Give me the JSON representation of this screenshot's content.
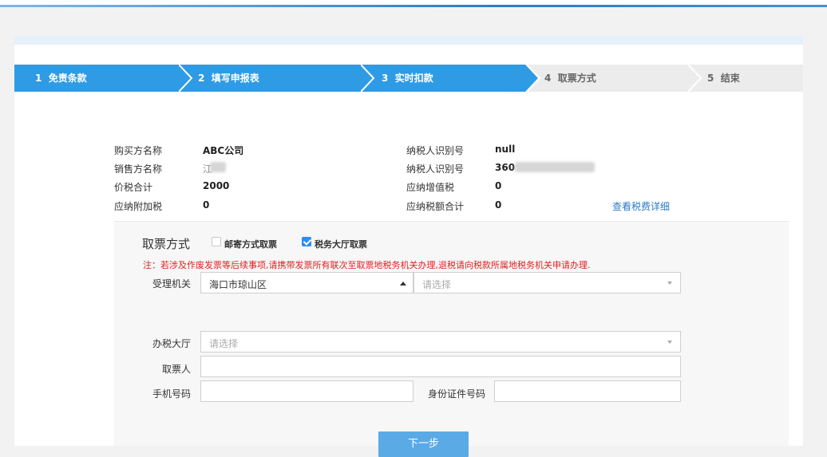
{
  "steps": [
    {
      "number": "1",
      "label": "免责条款"
    },
    {
      "number": "2",
      "label": "填写申报表"
    },
    {
      "number": "3",
      "label": "实时扣款"
    },
    {
      "number": "4",
      "label": "取票方式"
    },
    {
      "number": "5",
      "label": "结束"
    }
  ],
  "colors": {
    "step_active": "#2f9be4",
    "step_inactive": "#ececec",
    "accent": "#2d8cf0",
    "notice": "#e02020",
    "link": "#2a7ac7",
    "button": "#5aaae6"
  },
  "info": {
    "buyer_name_label": "购买方名称",
    "buyer_name_value": "ABC公司",
    "seller_name_label": "销售方名称",
    "seller_name_value": "江",
    "total_label": "价税合计",
    "total_value": "2000",
    "surtax_label": "应纳附加税",
    "surtax_value": "0",
    "buyer_taxid_label": "纳税人识别号",
    "buyer_taxid_value": "null",
    "seller_taxid_label": "纳税人识别号",
    "seller_taxid_value": "360",
    "vat_label": "应纳增值税",
    "vat_value": "0",
    "tax_total_label": "应纳税额合计",
    "tax_total_value": "0",
    "detail_link": "查看税费详细"
  },
  "pickup": {
    "title": "取票方式",
    "option_mail_label": "邮寄方式取票",
    "option_mail_checked": false,
    "option_hall_label": "税务大厅取票",
    "option_hall_checked": true,
    "notice": "注：若涉及作废发票等后续事项,请携带发票所有联次至取票地税务机关办理,退税请向税款所属地税务机关申请办理."
  },
  "form": {
    "authority_label": "受理机关",
    "authority_value": "海口市琼山区",
    "authority_sub_placeholder": "请选择",
    "hall_label": "办税大厅",
    "hall_placeholder": "请选择",
    "collector_label": "取票人",
    "collector_value": "",
    "phone_label": "手机号码",
    "phone_value": "",
    "idno_label": "身份证件号码",
    "idno_value": ""
  },
  "next_button": "下一步"
}
